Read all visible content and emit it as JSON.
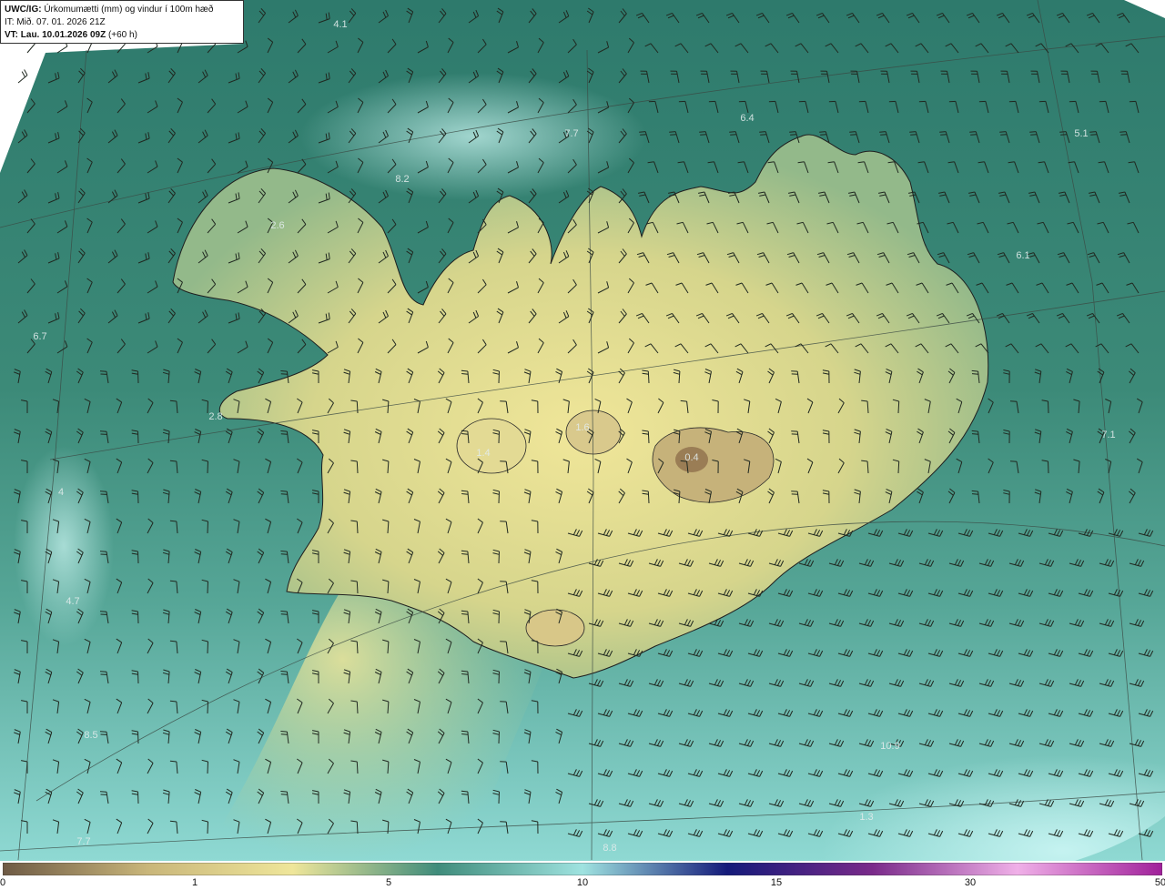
{
  "title": {
    "model": "UWC/IG:",
    "description": "Úrkomumætti (mm) og vindur í 100m hæð",
    "init_time": "IT: Mið. 07. 01. 2026 21Z",
    "valid_prefix": "VT: Lau. 10.01.2026 09Z",
    "valid_suffix": "(+60 h)"
  },
  "value_labels": [
    "4.1",
    "7.7",
    "6.4",
    "5.1",
    "8.2",
    "2.6",
    "6.1",
    "6.7",
    "2.8",
    "1.4",
    "1.6",
    "0.4",
    "7.1",
    "4",
    "4.7",
    "8.5",
    "10.9",
    "7.7",
    "8.8",
    "1.3"
  ],
  "colorbar": {
    "ticks": [
      "0",
      "1",
      "5",
      "10",
      "15",
      "30",
      "50"
    ],
    "colors": [
      "#6e5a45",
      "#c9b67a",
      "#efe69a",
      "#3f8c7b",
      "#9fe3e0",
      "#141a7a",
      "#7a2a8a",
      "#f0b0e8",
      "#a0209a"
    ]
  },
  "colors": {
    "ocean_dark": "#2f7a6d",
    "ocean_light": "#aeeaea",
    "land_low": "#7fab80",
    "land_mid": "#e6de8f",
    "land_high": "#9a7d55",
    "coastline": "#222222"
  }
}
